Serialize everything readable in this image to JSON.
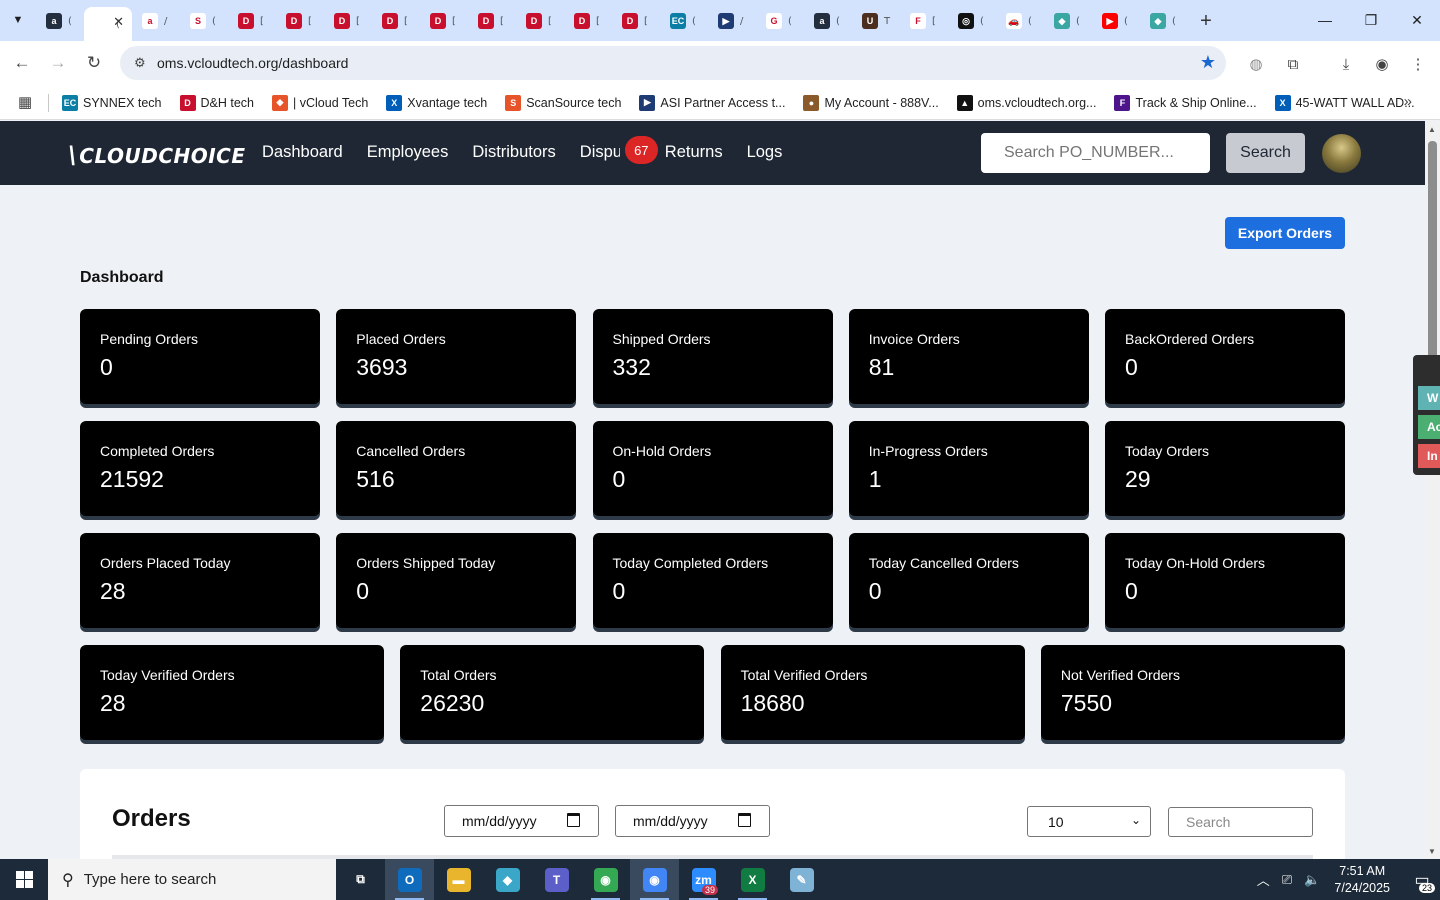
{
  "browser": {
    "tabs": [
      {
        "icon": "amazon-icon",
        "color": "#232f3e",
        "glyph": "a",
        "title": "("
      },
      {
        "icon": "vcloud-icon",
        "color": "#ffffff",
        "glyph": "",
        "title": "(",
        "active": true
      },
      {
        "icon": "amazon-icon",
        "color": "#ffffff",
        "glyph": "a",
        "title": "/"
      },
      {
        "icon": "scansource-icon",
        "color": "#ffffff",
        "glyph": "S",
        "title": "("
      },
      {
        "icon": "dh-icon",
        "color": "#c8102e",
        "glyph": "D",
        "title": "["
      },
      {
        "icon": "dh-icon",
        "color": "#c8102e",
        "glyph": "D",
        "title": "["
      },
      {
        "icon": "dh-icon",
        "color": "#c8102e",
        "glyph": "D",
        "title": "["
      },
      {
        "icon": "dh-icon",
        "color": "#c8102e",
        "glyph": "D",
        "title": "["
      },
      {
        "icon": "dh-icon",
        "color": "#c8102e",
        "glyph": "D",
        "title": "["
      },
      {
        "icon": "dh-icon",
        "color": "#c8102e",
        "glyph": "D",
        "title": "["
      },
      {
        "icon": "dh-icon",
        "color": "#c8102e",
        "glyph": "D",
        "title": "["
      },
      {
        "icon": "dh-icon",
        "color": "#c8102e",
        "glyph": "D",
        "title": "["
      },
      {
        "icon": "dh-icon",
        "color": "#c8102e",
        "glyph": "D",
        "title": "["
      },
      {
        "icon": "synnex-icon",
        "color": "#0a7ea4",
        "glyph": "EC",
        "title": "("
      },
      {
        "icon": "asi-icon",
        "color": "#1f3b73",
        "glyph": "▶",
        "title": "/"
      },
      {
        "icon": "google-icon",
        "color": "#ffffff",
        "glyph": "G",
        "title": "("
      },
      {
        "icon": "amazon-icon",
        "color": "#232f3e",
        "glyph": "a",
        "title": "("
      },
      {
        "icon": "ups-icon",
        "color": "#4b2e1e",
        "glyph": "U",
        "title": "T"
      },
      {
        "icon": "fedex-icon",
        "color": "#ffffff",
        "glyph": "F",
        "title": "["
      },
      {
        "icon": "openai-icon",
        "color": "#111111",
        "glyph": "◎",
        "title": "("
      },
      {
        "icon": "car-icon",
        "color": "#ffffff",
        "glyph": "🚗",
        "title": "("
      },
      {
        "icon": "hex-icon",
        "color": "#3aa7a3",
        "glyph": "◆",
        "title": "("
      },
      {
        "icon": "youtube-icon",
        "color": "#ff0000",
        "glyph": "▶",
        "title": "("
      },
      {
        "icon": "hex-icon",
        "color": "#3aa7a3",
        "glyph": "◆",
        "title": "("
      }
    ],
    "url": "oms.vcloudtech.org/dashboard",
    "bookmarks": [
      {
        "label": "SYNNEX tech",
        "icon": "synnex-icon",
        "color": "#0a7ea4",
        "glyph": "EC"
      },
      {
        "label": "D&H tech",
        "icon": "dh-icon",
        "color": "#c8102e",
        "glyph": "D"
      },
      {
        "label": "| vCloud Tech",
        "icon": "vcloud-icon",
        "color": "#e8542a",
        "glyph": "◆"
      },
      {
        "label": "Xvantage tech",
        "icon": "xvantage-icon",
        "color": "#005eb8",
        "glyph": "X"
      },
      {
        "label": "ScanSource tech",
        "icon": "scansource-icon",
        "color": "#e8542a",
        "glyph": "S"
      },
      {
        "label": "ASI Partner Access t...",
        "icon": "asi-icon",
        "color": "#1f3b73",
        "glyph": "▶"
      },
      {
        "label": "My Account - 888V...",
        "icon": "account-icon",
        "color": "#8a5a2b",
        "glyph": "●"
      },
      {
        "label": "oms.vcloudtech.org...",
        "icon": "oms-icon",
        "color": "#111111",
        "glyph": "▲"
      },
      {
        "label": "Track & Ship Online...",
        "icon": "fedex-icon",
        "color": "#4d148c",
        "glyph": "F"
      },
      {
        "label": "45-WATT WALL AD...",
        "icon": "xvantage-icon",
        "color": "#005eb8",
        "glyph": "X"
      }
    ]
  },
  "app": {
    "logo": "CLOUDCHOICE",
    "nav": {
      "dashboard": "Dashboard",
      "employees": "Employees",
      "distributors": "Distributors",
      "disputes": "Disputes",
      "disputes_badge": "67",
      "returns": "Returns",
      "logs": "Logs"
    },
    "search_placeholder": "Search PO_NUMBER...",
    "search_button": "Search",
    "export_button": "Export Orders",
    "dashboard_title": "Dashboard",
    "cards": [
      {
        "label": "Pending Orders",
        "value": "0"
      },
      {
        "label": "Placed Orders",
        "value": "3693"
      },
      {
        "label": "Shipped Orders",
        "value": "332"
      },
      {
        "label": "Invoice Orders",
        "value": "81"
      },
      {
        "label": "BackOrdered Orders",
        "value": "0"
      },
      {
        "label": "Completed Orders",
        "value": "21592"
      },
      {
        "label": "Cancelled Orders",
        "value": "516"
      },
      {
        "label": "On-Hold Orders",
        "value": "0"
      },
      {
        "label": "In-Progress Orders",
        "value": "1"
      },
      {
        "label": "Today Orders",
        "value": "29"
      },
      {
        "label": "Orders Placed Today",
        "value": "28"
      },
      {
        "label": "Orders Shipped Today",
        "value": "0"
      },
      {
        "label": "Today Completed Orders",
        "value": "0"
      },
      {
        "label": "Today Cancelled Orders",
        "value": "0"
      },
      {
        "label": "Today On-Hold Orders",
        "value": "0"
      },
      {
        "label": "Today Verified Orders",
        "value": "28"
      },
      {
        "label": "Total Orders",
        "value": "26230"
      },
      {
        "label": "Total Verified Orders",
        "value": "18680"
      },
      {
        "label": "Not Verified Orders",
        "value": "7550"
      }
    ],
    "orders": {
      "title": "Orders",
      "date_from": "mm/dd/yyyy",
      "date_to": "mm/dd/yyyy",
      "page_size": "10",
      "search_placeholder": "Search"
    },
    "side_tabs": [
      {
        "label": "W",
        "color": "#5fb3b3"
      },
      {
        "label": "Ac",
        "color": "#4caf72"
      },
      {
        "label": "In",
        "color": "#e05a5a"
      }
    ]
  },
  "taskbar": {
    "search_placeholder": "Type here to search",
    "apps": [
      {
        "icon": "task-view-icon",
        "color": "transparent",
        "glyph": "⧉"
      },
      {
        "icon": "outlook-icon",
        "color": "#0f6cbd",
        "glyph": "O",
        "running": true,
        "focused": true
      },
      {
        "icon": "file-explorer-icon",
        "color": "#e8b52c",
        "glyph": "▬"
      },
      {
        "icon": "app-diamond-icon",
        "color": "#3aa7c9",
        "glyph": "◆"
      },
      {
        "icon": "teams-icon",
        "color": "#5b5fc7",
        "glyph": "T"
      },
      {
        "icon": "chrome-icon",
        "color": "#34a853",
        "glyph": "◉",
        "running": true
      },
      {
        "icon": "chrome-icon",
        "color": "#4285f4",
        "glyph": "◉",
        "running": true,
        "focused": true
      },
      {
        "icon": "zoom-icon",
        "color": "#2d8cff",
        "glyph": "zm",
        "running": true,
        "count": "39"
      },
      {
        "icon": "excel-icon",
        "color": "#107c41",
        "glyph": "X",
        "running": true
      },
      {
        "icon": "notepad-icon",
        "color": "#7fb3d5",
        "glyph": "✎"
      }
    ],
    "time": "7:51 AM",
    "date": "7/24/2025",
    "notifications": "23"
  }
}
